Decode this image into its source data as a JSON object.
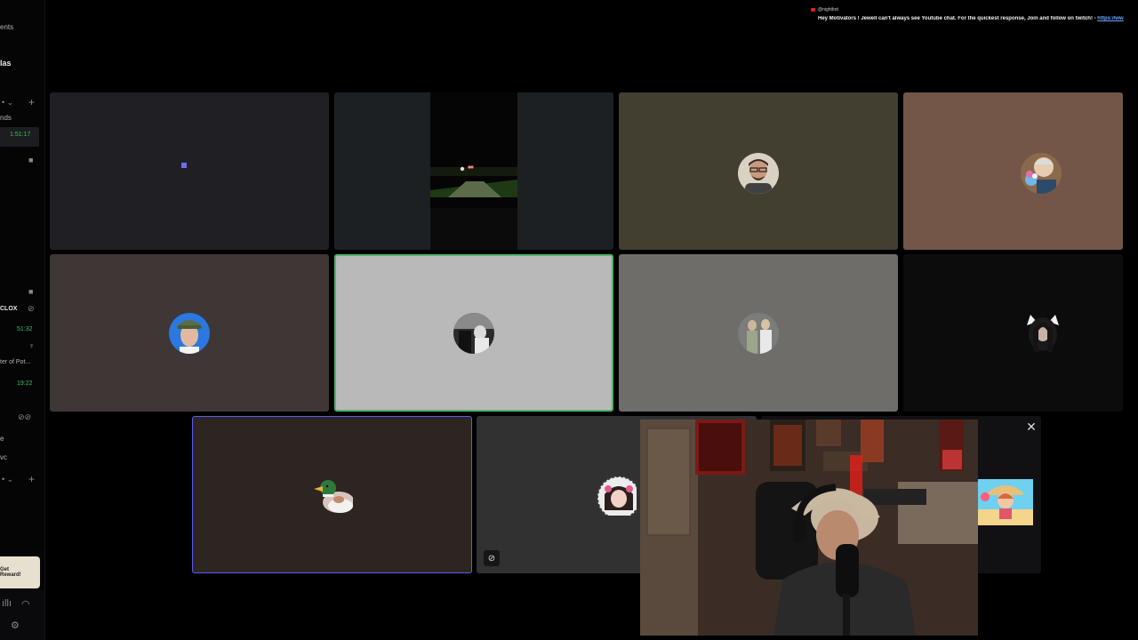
{
  "sidebar": {
    "items": [
      {
        "text": "ents"
      },
      {
        "text": "las"
      },
      {
        "text": "nds"
      },
      {
        "text": "CLOX"
      },
      {
        "text": "ter of Pot..."
      },
      {
        "text": "e"
      },
      {
        "text": "vc"
      }
    ],
    "times": [
      "1:51:17",
      "51:32",
      "19:22"
    ],
    "reward_label": "Get Reward!"
  },
  "chat_overlay": {
    "username": "@nightbot",
    "message": "Hey Motivators ! Jewell can't always see Youtube chat. For the quickest response, Join and follow on twitch! - ",
    "link": "https://ww"
  },
  "participants": [
    {
      "id": "tile-1",
      "bg": "#202024",
      "kind": "empty"
    },
    {
      "id": "tile-2",
      "bg": "#1c2022",
      "kind": "video-night-road"
    },
    {
      "id": "tile-3",
      "bg": "#423f31",
      "kind": "avatar-man-glasses"
    },
    {
      "id": "tile-4",
      "bg": "#735648",
      "kind": "avatar-man-flowers"
    },
    {
      "id": "tile-5",
      "bg": "#3f3636",
      "kind": "avatar-man-cap"
    },
    {
      "id": "tile-6",
      "bg": "#b9b9b9",
      "kind": "avatar-bw-photo",
      "speaking": true
    },
    {
      "id": "tile-7",
      "bg": "#6f6d69",
      "kind": "avatar-two-people"
    },
    {
      "id": "tile-8",
      "bg": "#0c0c0d",
      "kind": "avatar-woman-cat-ears"
    },
    {
      "id": "tile-9",
      "bg": "#2d2521",
      "kind": "avatar-duck",
      "selected": true
    },
    {
      "id": "tile-10",
      "bg": "#313132",
      "kind": "avatar-anime-girl",
      "muted": true
    },
    {
      "id": "tile-11",
      "bg": "#111113",
      "kind": "avatar-cartoon-beach"
    }
  ],
  "colors": {
    "speaking_border": "#4fb56a",
    "selected_border": "#5a5cf0",
    "time_green": "#3fbf5f"
  },
  "icons": [
    "plus-icon",
    "camera-icon",
    "mic-off-icon",
    "headphones-icon",
    "close-icon",
    "settings-icon"
  ]
}
